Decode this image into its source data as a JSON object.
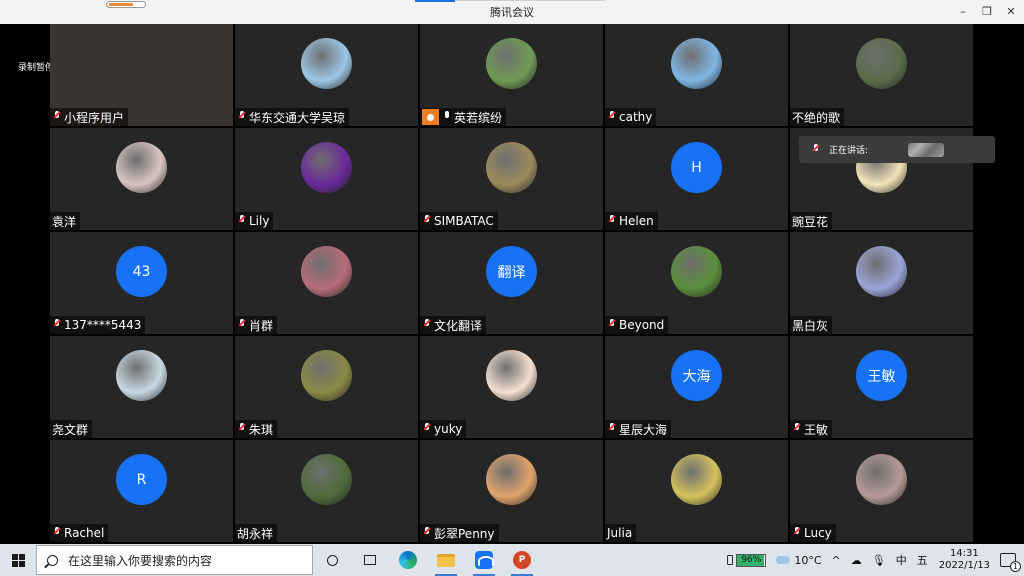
{
  "window": {
    "title": "腾讯会议",
    "recording_label": "录制暂停",
    "controls": {
      "minimize": "–",
      "restore": "❐",
      "close": "✕"
    }
  },
  "speaking": {
    "label": "正在讲话:"
  },
  "participants": [
    {
      "name": "小程序用户",
      "mic": "muted",
      "avatar": "photo",
      "color": "#3a3430"
    },
    {
      "name": "华东交通大学吴琼",
      "mic": "muted",
      "avatar": "photo",
      "color": "#9cc7e6"
    },
    {
      "name": "英若缤纷",
      "mic": "on",
      "host_tag": true,
      "avatar": "photo",
      "color": "#6f9a55"
    },
    {
      "name": "cathy",
      "mic": "muted",
      "avatar": "photo",
      "color": "#7fb6e5"
    },
    {
      "name": "不绝的歌",
      "mic": "none",
      "avatar": "photo",
      "color": "#5b6c4a"
    },
    {
      "name": "袁洋",
      "mic": "none",
      "avatar": "photo",
      "color": "#d8c4c2"
    },
    {
      "name": "Lily",
      "mic": "muted",
      "avatar": "photo",
      "color": "#6a2a9a"
    },
    {
      "name": "SIMBATAC",
      "mic": "muted",
      "avatar": "photo",
      "color": "#9c8a5c"
    },
    {
      "name": "Helen",
      "mic": "muted",
      "avatar": "initial",
      "initial": "H"
    },
    {
      "name": "豌豆花",
      "mic": "none",
      "avatar": "photo",
      "color": "#f2e3b8"
    },
    {
      "name": "137****5443",
      "mic": "muted",
      "avatar": "initial",
      "initial": "43"
    },
    {
      "name": "肖群",
      "mic": "muted",
      "avatar": "photo",
      "color": "#b76c7a"
    },
    {
      "name": "文化翻译",
      "mic": "muted",
      "avatar": "initial",
      "initial": "翻译"
    },
    {
      "name": "Beyond",
      "mic": "muted",
      "avatar": "photo",
      "color": "#5a8f3b"
    },
    {
      "name": "黑白灰",
      "mic": "none",
      "avatar": "photo",
      "color": "#9aa4d8"
    },
    {
      "name": "尧文群",
      "mic": "none",
      "avatar": "photo",
      "color": "#c8d8e2"
    },
    {
      "name": "朱琪",
      "mic": "muted",
      "avatar": "photo",
      "color": "#8b8a45"
    },
    {
      "name": "yuky",
      "mic": "muted",
      "avatar": "photo",
      "color": "#f4dfd0"
    },
    {
      "name": "星辰大海",
      "mic": "muted",
      "avatar": "initial",
      "initial": "大海"
    },
    {
      "name": "王敏",
      "mic": "muted",
      "avatar": "initial",
      "initial": "王敏"
    },
    {
      "name": "Rachel",
      "mic": "muted",
      "avatar": "initial",
      "initial": "R"
    },
    {
      "name": "胡永祥",
      "mic": "none",
      "avatar": "photo",
      "color": "#4f6b3a"
    },
    {
      "name": "彭翠Penny",
      "mic": "muted",
      "avatar": "photo",
      "color": "#e0a46b"
    },
    {
      "name": "Julia",
      "mic": "none",
      "avatar": "photo",
      "color": "#d5c25d"
    },
    {
      "name": "Lucy",
      "mic": "muted",
      "avatar": "photo",
      "color": "#b59a96"
    }
  ],
  "taskbar": {
    "search_placeholder": "在这里输入你要搜索的内容",
    "battery_label": "96%",
    "battery_level": 96,
    "weather": "10°C",
    "ime_lang": "中",
    "ime_mode": "五",
    "tray_chevron": "^",
    "time": "14:31",
    "date": "2022/1/13",
    "notification_count": "1",
    "ppt_letter": "P"
  }
}
